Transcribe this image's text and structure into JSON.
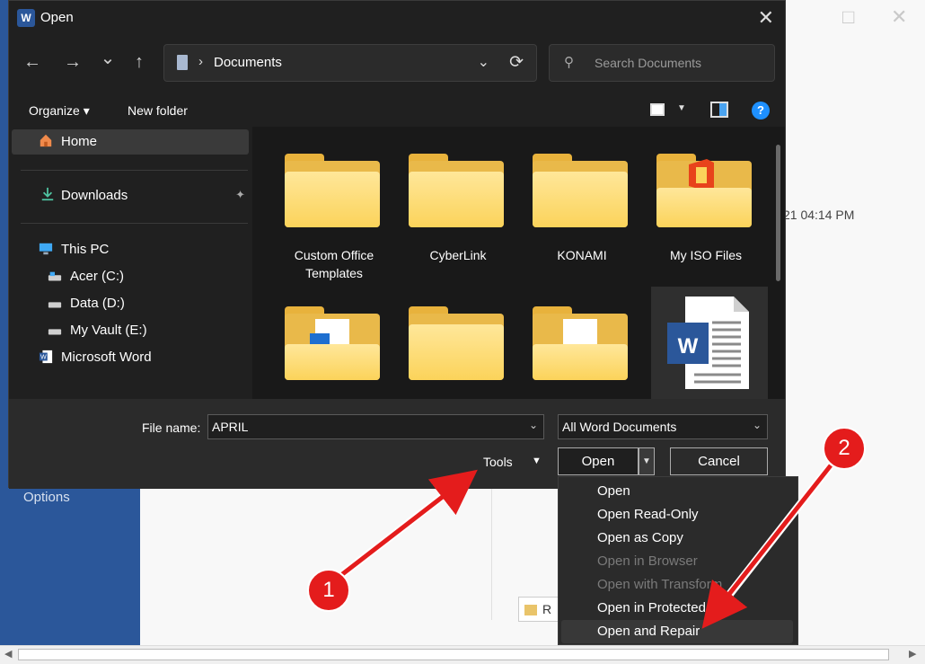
{
  "background": {
    "options_label": "Options",
    "timestamp_fragment": "21 04:14 PM",
    "recent_button_fragment": "R"
  },
  "dialog": {
    "title": "Open",
    "app_icon_letter": "W",
    "close_glyph": "✕"
  },
  "navigation": {
    "back_glyph": "←",
    "forward_glyph": "→",
    "recent_glyph": "⌄",
    "up_glyph": "↑",
    "breadcrumb_separator": "›",
    "current_folder": "Documents",
    "dropdown_glyph": "⌄",
    "refresh_glyph": "⟳"
  },
  "search": {
    "placeholder": "Search Documents",
    "icon_glyph": "⚲"
  },
  "command_bar": {
    "organize_label": "Organize ▾",
    "new_folder_label": "New folder",
    "view_caret": "▼",
    "help_glyph": "?"
  },
  "sidebar": {
    "items": [
      {
        "label": "Home",
        "icon": "home-icon"
      },
      {
        "label": "Downloads",
        "icon": "download-icon"
      },
      {
        "label": "This PC",
        "icon": "pc-icon"
      },
      {
        "label": "Acer (C:)",
        "icon": "drive-icon"
      },
      {
        "label": "Data (D:)",
        "icon": "drive-icon"
      },
      {
        "label": "My Vault (E:)",
        "icon": "drive-icon"
      },
      {
        "label": "Microsoft Word",
        "icon": "word-icon"
      }
    ],
    "pin_glyph": "📌"
  },
  "files": {
    "items": [
      {
        "label": "Custom Office Templates",
        "label_line1": "Custom Office",
        "label_line2": "Templates",
        "type": "folder"
      },
      {
        "label": "CyberLink",
        "type": "folder"
      },
      {
        "label": "KONAMI",
        "type": "folder"
      },
      {
        "label": "My ISO Files",
        "type": "folder"
      },
      {
        "label": "",
        "type": "folder"
      },
      {
        "label": "",
        "type": "folder"
      },
      {
        "label": "",
        "type": "folder"
      },
      {
        "label": "",
        "type": "word-document"
      }
    ],
    "word_doc_letter": "W"
  },
  "footer": {
    "file_name_label": "File name:",
    "file_name_value": "APRIL",
    "file_type_value": "All Word Documents",
    "dropdown_glyph": "⌄",
    "tools_label": "Tools",
    "tools_caret": "▼",
    "open_label": "Open",
    "open_split_glyph": "▼",
    "cancel_label": "Cancel"
  },
  "open_menu": {
    "items": [
      {
        "label": "Open",
        "enabled": true
      },
      {
        "label": "Open Read-Only",
        "enabled": true
      },
      {
        "label": "Open as Copy",
        "enabled": true
      },
      {
        "label": "Open in Browser",
        "enabled": false
      },
      {
        "label": "Open with Transform",
        "enabled": false
      },
      {
        "label": "Open in Protected View",
        "enabled": true
      },
      {
        "label": "Open and Repair",
        "enabled": true,
        "highlighted": true
      }
    ]
  },
  "annotations": {
    "badge_1": "1",
    "badge_2": "2",
    "arrow_color": "#e41c1c"
  },
  "colors": {
    "dialog_bg": "#202020",
    "word_blue": "#2b579a",
    "folder_yellow": "#fbd35a",
    "accent_blue": "#1e90ff"
  }
}
